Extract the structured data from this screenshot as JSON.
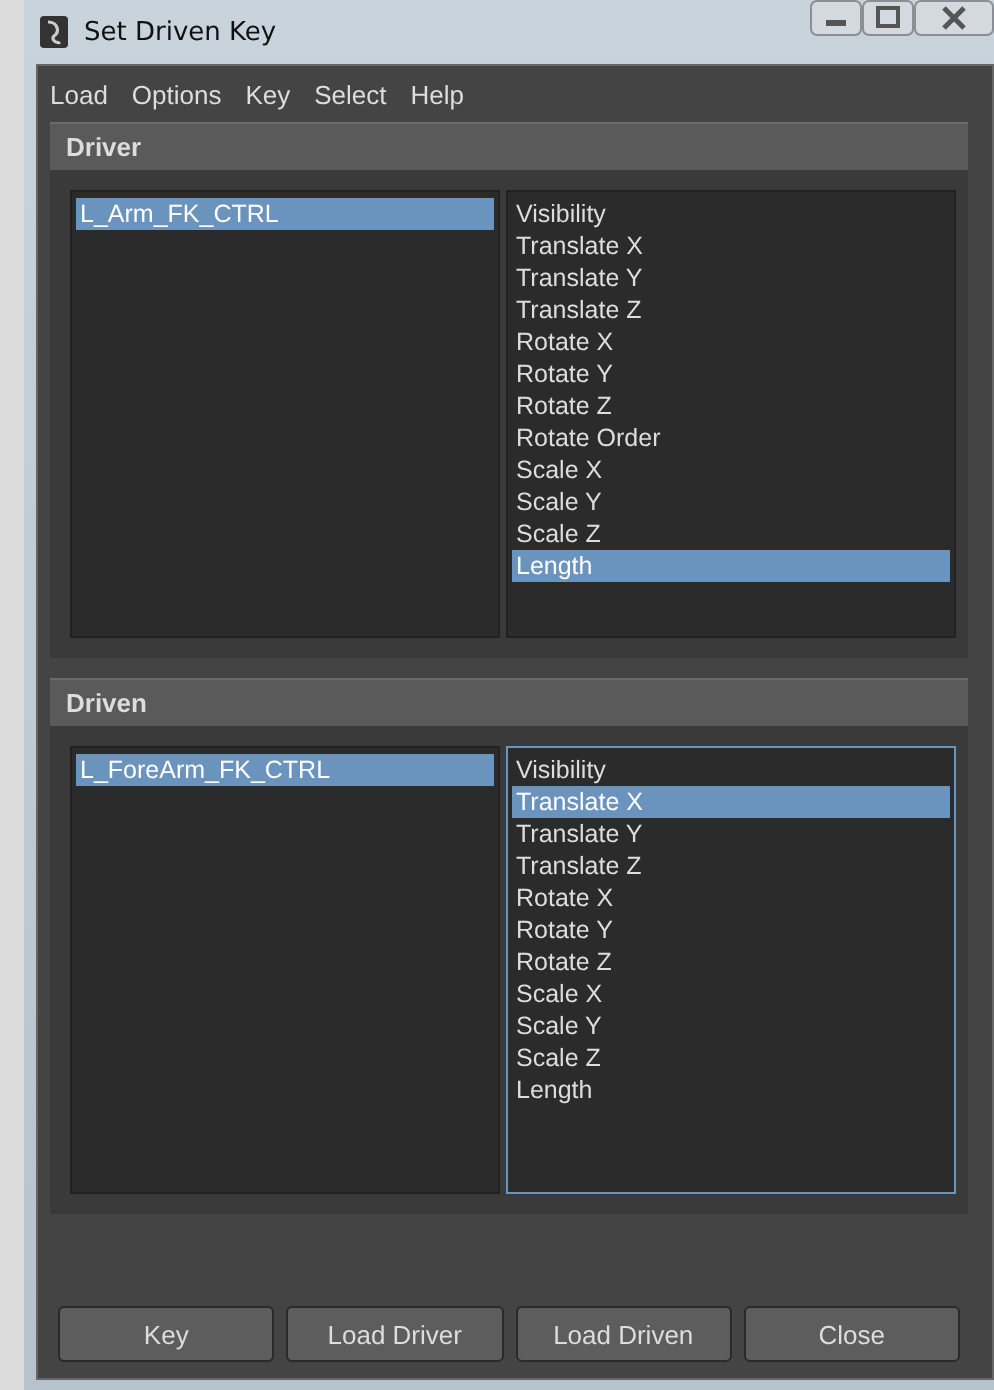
{
  "window": {
    "title": "Set Driven Key"
  },
  "menu": [
    "Load",
    "Options",
    "Key",
    "Select",
    "Help"
  ],
  "sections": [
    {
      "title": "Driver",
      "objects": [
        {
          "label": "L_Arm_FK_CTRL",
          "selected": true
        }
      ],
      "focused": false,
      "attributes": [
        {
          "label": "Visibility",
          "selected": false
        },
        {
          "label": "Translate X",
          "selected": false
        },
        {
          "label": "Translate Y",
          "selected": false
        },
        {
          "label": "Translate Z",
          "selected": false
        },
        {
          "label": "Rotate X",
          "selected": false
        },
        {
          "label": "Rotate Y",
          "selected": false
        },
        {
          "label": "Rotate Z",
          "selected": false
        },
        {
          "label": "Rotate Order",
          "selected": false
        },
        {
          "label": "Scale X",
          "selected": false
        },
        {
          "label": "Scale Y",
          "selected": false
        },
        {
          "label": "Scale Z",
          "selected": false
        },
        {
          "label": "Length",
          "selected": true
        }
      ]
    },
    {
      "title": "Driven",
      "objects": [
        {
          "label": "L_ForeArm_FK_CTRL",
          "selected": true
        }
      ],
      "focused": true,
      "attributes": [
        {
          "label": "Visibility",
          "selected": false
        },
        {
          "label": "Translate X",
          "selected": true
        },
        {
          "label": "Translate Y",
          "selected": false
        },
        {
          "label": "Translate Z",
          "selected": false
        },
        {
          "label": "Rotate X",
          "selected": false
        },
        {
          "label": "Rotate Y",
          "selected": false
        },
        {
          "label": "Rotate Z",
          "selected": false
        },
        {
          "label": "Scale X",
          "selected": false
        },
        {
          "label": "Scale Y",
          "selected": false
        },
        {
          "label": "Scale Z",
          "selected": false
        },
        {
          "label": "Length",
          "selected": false
        }
      ]
    }
  ],
  "buttons": [
    "Key",
    "Load Driver",
    "Load Driven",
    "Close"
  ]
}
